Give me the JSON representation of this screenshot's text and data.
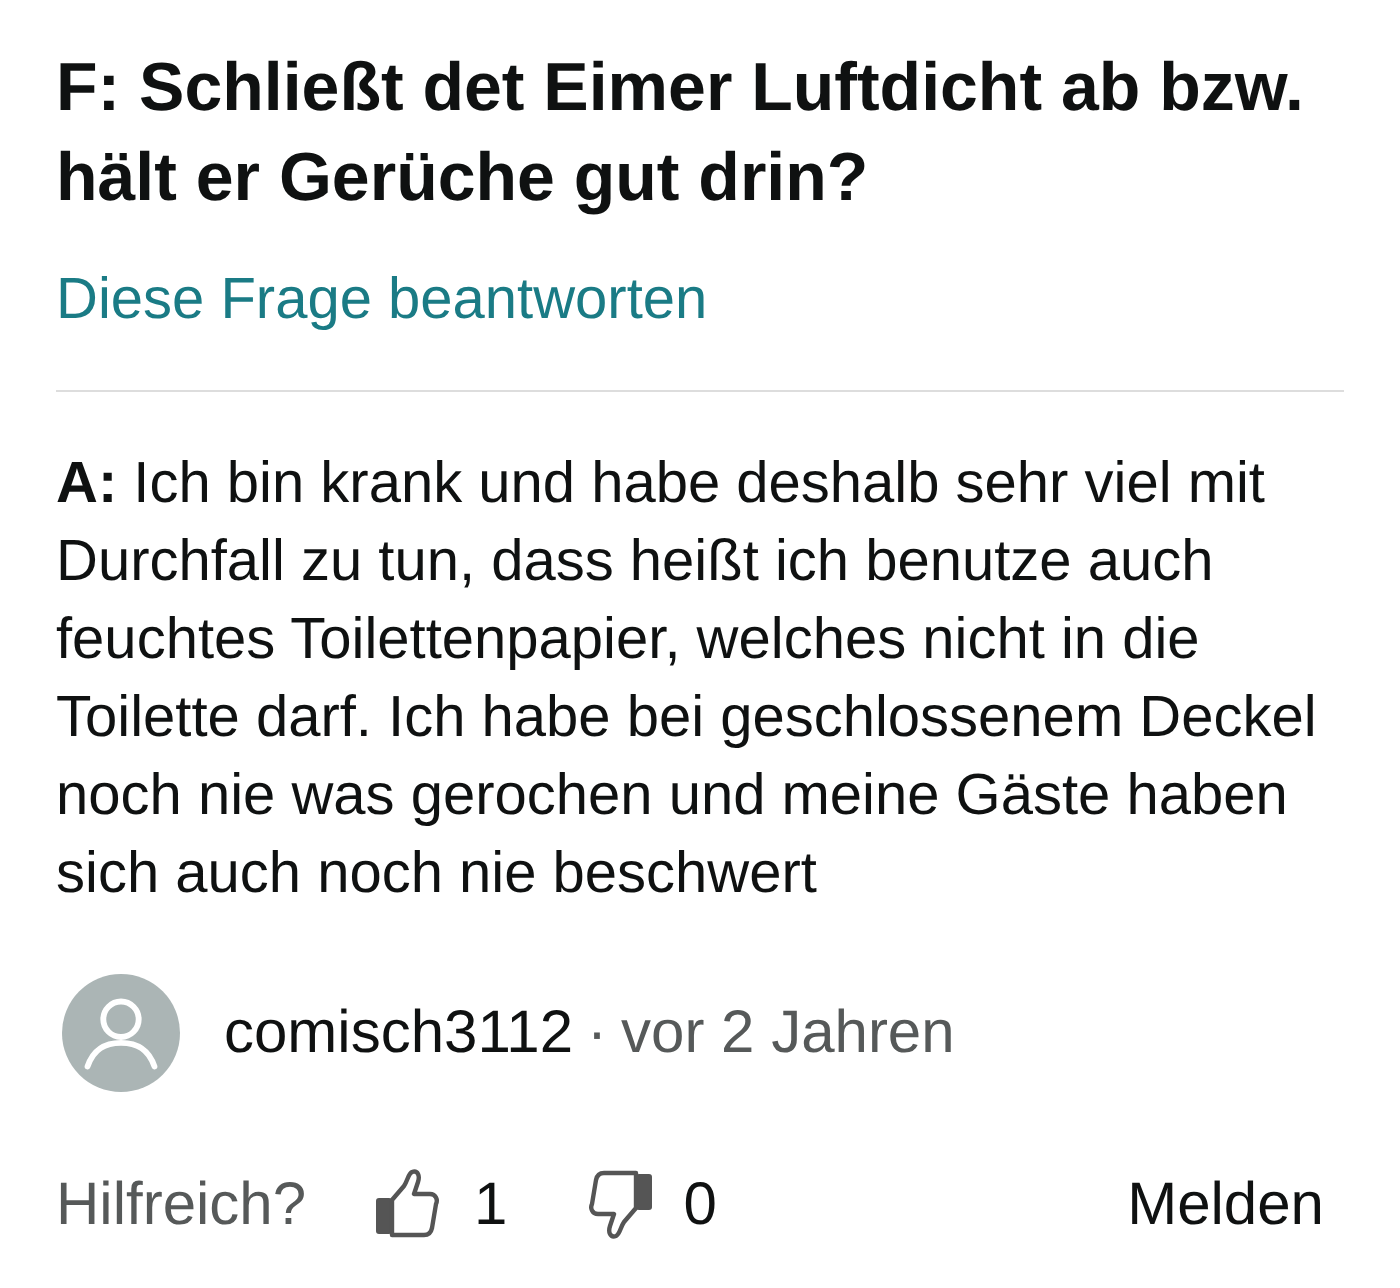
{
  "question": {
    "text": "F: Schließt det Eimer Luftdicht ab bzw. hält er Gerüche gut drin?",
    "answer_link": "Diese Frage beantworten"
  },
  "answer": {
    "text": "**A:** Ich bin krank und habe deshalb sehr viel mit Durchfall zu tun, dass heißt ich benutze auch feuchtes Toilettenpapier, welches nicht in die Toilette darf. Ich habe bei geschlossenem Deckel noch nie was gerochen und meine Gäste haben sich auch noch nie beschwert",
    "author": "comisch3112",
    "separator": "·",
    "date": "vor 2 Jahren"
  },
  "feedback": {
    "label": "Hilfreich?",
    "upvotes": "1",
    "downvotes": "0",
    "report": "Melden"
  }
}
